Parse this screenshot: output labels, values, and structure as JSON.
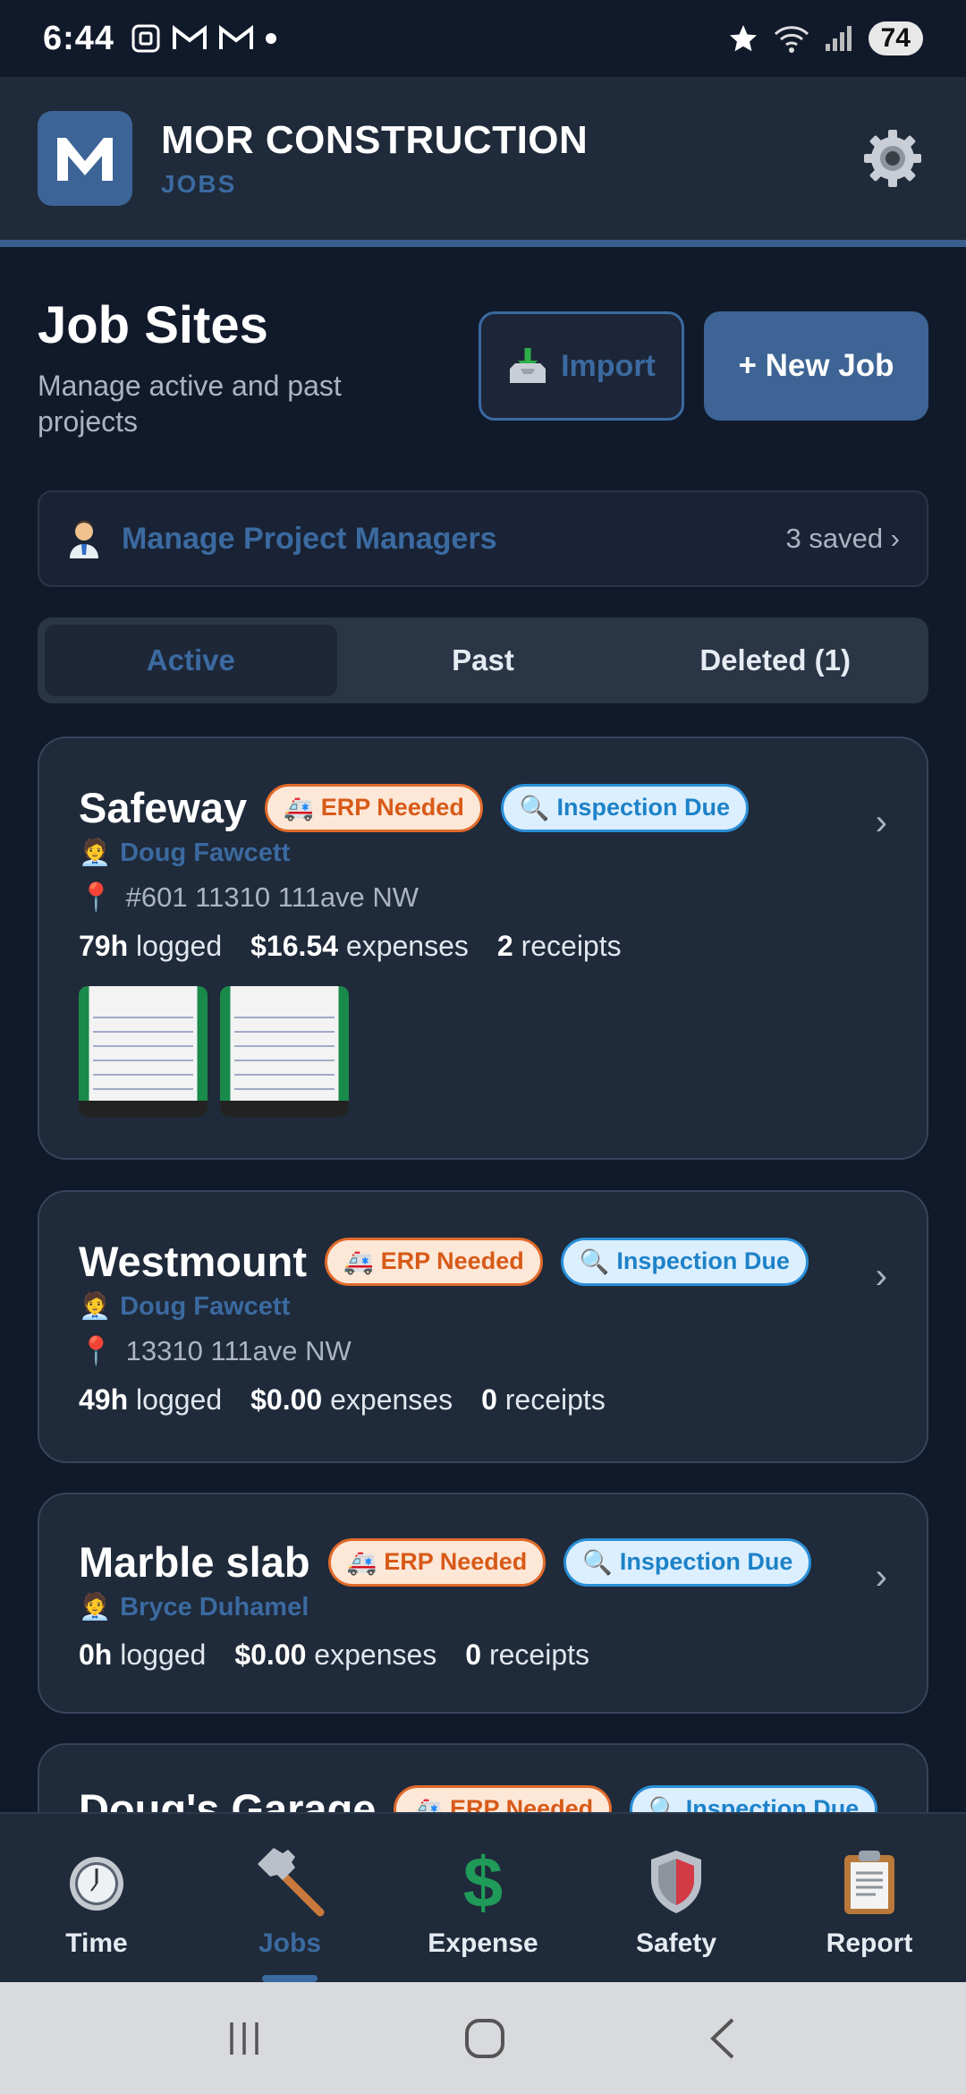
{
  "status_bar": {
    "time": "6:44",
    "battery": "74"
  },
  "header": {
    "company": "MOR CONSTRUCTION",
    "section": "JOBS"
  },
  "page": {
    "title": "Job Sites",
    "subtitle": "Manage active and past projects",
    "import_label": "Import",
    "new_job_label": "+ New Job"
  },
  "managers": {
    "label": "Manage Project Managers",
    "count": "3 saved ›"
  },
  "tabs": [
    {
      "label": "Active"
    },
    {
      "label": "Past"
    },
    {
      "label": "Deleted (1)"
    }
  ],
  "jobs": [
    {
      "name": "Safeway",
      "erp_badge": "ERP Needed",
      "inspection_badge": "Inspection Due",
      "manager": "Doug Fawcett",
      "address": "#601 11310 111ave NW",
      "hours": "79h",
      "hours_label": "logged",
      "expenses": "$16.54",
      "expenses_label": "expenses",
      "receipts": "2",
      "receipts_label": "receipts"
    },
    {
      "name": "Westmount",
      "erp_badge": "ERP Needed",
      "inspection_badge": "Inspection Due",
      "manager": "Doug Fawcett",
      "address": "13310 111ave NW",
      "hours": "49h",
      "hours_label": "logged",
      "expenses": "$0.00",
      "expenses_label": "expenses",
      "receipts": "0",
      "receipts_label": "receipts"
    },
    {
      "name": "Marble slab",
      "erp_badge": "ERP Needed",
      "inspection_badge": "Inspection Due",
      "manager": "Bryce Duhamel",
      "hours": "0h",
      "hours_label": "logged",
      "expenses": "$0.00",
      "expenses_label": "expenses",
      "receipts": "0",
      "receipts_label": "receipts"
    },
    {
      "name": "Doug's Garage",
      "erp_badge": "ERP Needed",
      "inspection_badge": "Inspection Due"
    }
  ],
  "bottom_nav": [
    {
      "label": "Time"
    },
    {
      "label": "Jobs"
    },
    {
      "label": "Expense"
    },
    {
      "label": "Safety"
    },
    {
      "label": "Report"
    }
  ],
  "colors": {
    "accent": "#3b6aa0",
    "erp": "#d85a18",
    "inspection": "#1d82c8"
  }
}
